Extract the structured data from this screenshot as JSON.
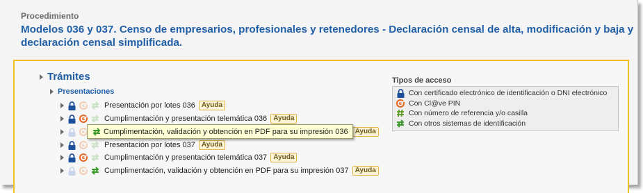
{
  "section_label": "Procedimiento",
  "title": "Modelos 036 y 037. Censo de empresarios, profesionales y retenedores - Declaración censal de alta, modificación y baja y declaración censal simplificada.",
  "tramites_label": "Trámites",
  "presentaciones_label": "Presentaciones",
  "ayuda_label": "Ayuda",
  "rows": [
    {
      "label": "Presentación por lotes 036",
      "icons": [
        "lock-blue",
        "clave-faded",
        "arrows-faded"
      ]
    },
    {
      "label": "Cumplimentación y presentación telemática 036",
      "icons": [
        "lock-blue",
        "clave",
        "arrows-faded"
      ]
    },
    {
      "label": "Cumplimentación, validación y obtención en PDF para su impresión 036",
      "icons": [
        "lock-faded",
        "clave-faded",
        "arrows"
      ]
    },
    {
      "label": "Presentación por lotes 037",
      "icons": [
        "lock-blue",
        "clave-faded",
        "arrows-faded"
      ]
    },
    {
      "label": "Cumplimentación y presentación telemática 037",
      "icons": [
        "lock-blue",
        "clave",
        "arrows-faded"
      ]
    },
    {
      "label": "Cumplimentación, validación y obtención en PDF para su impresión 037",
      "icons": [
        "lock-faded",
        "clave-faded",
        "arrows"
      ]
    }
  ],
  "tooltip_text": "Cumplimentación, validación y obtención en PDF para su impresión 036",
  "legend": {
    "title": "Tipos de acceso",
    "items": [
      {
        "icon": "lock-icon",
        "label": "Con certificado electrónico de identificación o DNI electrónico"
      },
      {
        "icon": "clave-icon",
        "label": "Con Cl@ve PIN"
      },
      {
        "icon": "hash-icon",
        "label": "Con número de referencia y/o casilla"
      },
      {
        "icon": "arrows-icon",
        "label": "Con otros sistemas de identificación"
      }
    ]
  },
  "colors": {
    "title_blue": "#1f5fa8",
    "panel_border": "#f0c020",
    "lock_blue": "#1e4f9a",
    "clave_orange": "#e8661c",
    "arrows_green": "#3e9a2e",
    "hash_green": "#5a9a1e"
  }
}
